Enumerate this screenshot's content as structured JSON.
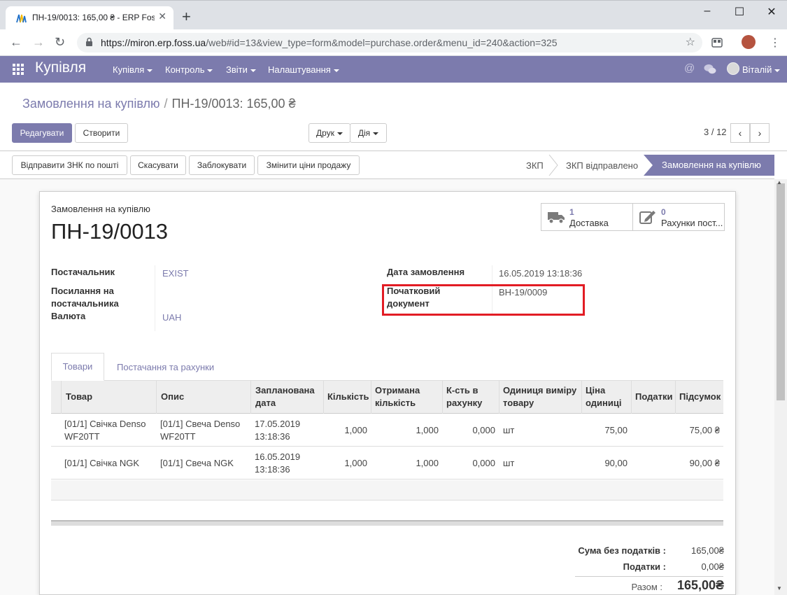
{
  "browser": {
    "tab_title": "ПН-19/0013: 165,00 ₴ - ERP Foss",
    "url_host": "https://miron.erp.foss.ua",
    "url_rest": "/web#id=13&view_type=form&model=purchase.order&menu_id=240&action=325"
  },
  "navbar": {
    "app_title": "Купівля",
    "menus": [
      "Купівля",
      "Контроль",
      "Звіти",
      "Налаштування"
    ],
    "user": "Віталій",
    "color": "#7c7bad"
  },
  "breadcrumb": {
    "parent": "Замовлення на купівлю",
    "current": "ПН-19/0013: 165,00 ₴"
  },
  "buttons": {
    "edit": "Редагувати",
    "create": "Створити",
    "print": "Друк",
    "action": "Дія"
  },
  "pager": "3 / 12",
  "header_buttons": [
    "Відправити ЗНК по пошті",
    "Скасувати",
    "Заблокувати",
    "Змінити ціни продажу"
  ],
  "stages": {
    "s1": "ЗКП",
    "s2": "ЗКП відправлено",
    "active": "Замовлення на купівлю"
  },
  "smart_buttons": {
    "delivery": {
      "count": "1",
      "label": "Доставка"
    },
    "bills": {
      "count": "0",
      "label": "Рахунки пост..."
    }
  },
  "form": {
    "doc_type": "Замовлення на купівлю",
    "name": "ПН-19/0013",
    "vendor_label": "Постачальник",
    "vendor_value": "EXIST",
    "vendor_ref_label_1": "Посилання на",
    "vendor_ref_label_2": "постачальника",
    "currency_label": "Валюта",
    "currency_value": "UAH",
    "order_date_label": "Дата замовлення",
    "order_date_value": "16.05.2019 13:18:36",
    "origin_label_1": "Початковий",
    "origin_label_2": "документ",
    "origin_value": "BH-19/0009"
  },
  "tabs": {
    "products": "Товари",
    "deliveries": "Постачання та рахунки"
  },
  "table": {
    "headers": {
      "product": "Товар",
      "description": "Опис",
      "date_1": "Запланована",
      "date_2": "дата",
      "qty": "Кількість",
      "received_1": "Отримана",
      "received_2": "кількість",
      "billed_1": "К-сть в",
      "billed_2": "рахунку",
      "uom_1": "Одиниця виміру",
      "uom_2": "товару",
      "price_1": "Ціна",
      "price_2": "одиниці",
      "taxes": "Податки",
      "subtotal": "Підсумок"
    },
    "rows": [
      {
        "product_1": "[01/1] Свічка Denso",
        "product_2": "WF20TT",
        "desc_1": "[01/1] Свеча Denso",
        "desc_2": "WF20TT",
        "date_1": "17.05.2019",
        "date_2": "13:18:36",
        "qty": "1,000",
        "received": "1,000",
        "billed": "0,000",
        "uom": "шт",
        "price": "75,00",
        "subtotal": "75,00 ₴"
      },
      {
        "product_1": "[01/1] Свічка NGK",
        "desc_1": "[01/1] Свеча NGK",
        "date_1": "16.05.2019",
        "date_2": "13:18:36",
        "qty": "1,000",
        "received": "1,000",
        "billed": "0,000",
        "uom": "шт",
        "price": "90,00",
        "subtotal": "90,00 ₴"
      }
    ]
  },
  "totals": {
    "untaxed_label": "Сума без податків :",
    "untaxed_value": "165,00₴",
    "taxes_label": "Податки :",
    "taxes_value": "0,00₴",
    "total_label": "Разом :",
    "total_value": "165,00₴"
  }
}
